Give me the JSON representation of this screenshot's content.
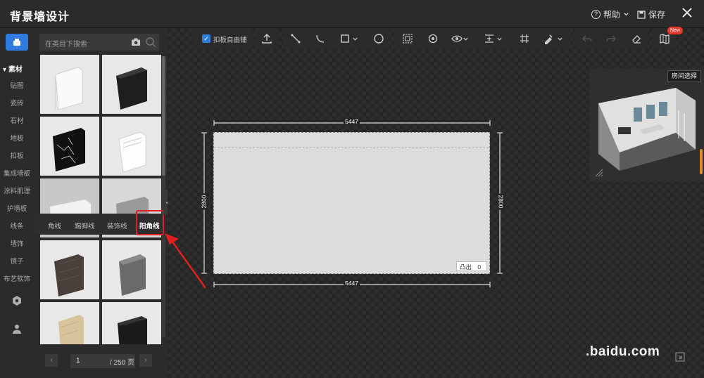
{
  "titlebar": {
    "title": "背景墙设计",
    "help_label": "帮助",
    "save_label": "保存"
  },
  "sidebar": {
    "section_label": "素材",
    "categories": [
      "贴图",
      "瓷砖",
      "石材",
      "地板",
      "扣板",
      "集成墙板",
      "涂料肌理",
      "护墙板",
      "线条",
      "墙饰",
      "镜子",
      "布艺软饰"
    ]
  },
  "panel": {
    "search_placeholder": "在类目下搜索",
    "tabs": [
      "角线",
      "踢脚线",
      "装饰线",
      "阳角线"
    ],
    "active_tab": "阳角线",
    "pager": {
      "current_page": "1",
      "total": "/ 250 页"
    }
  },
  "toolbar": {
    "free_tile_label": "扣板自由铺",
    "free_tile_checked": true,
    "new_badge": "New"
  },
  "wall": {
    "top_width": "5447",
    "bottom_width": "5447",
    "left_height": "2800",
    "right_height": "2800",
    "outcrop_label": "凸出",
    "outcrop_value": "0"
  },
  "preview": {
    "room_select_label": "房间选择"
  },
  "watermark": ".baidu.com",
  "colors": {
    "accent": "#2f7be0",
    "highlight": "#e02020",
    "new_badge": "#e23b2e",
    "scroll_accent": "#e08a2e"
  }
}
